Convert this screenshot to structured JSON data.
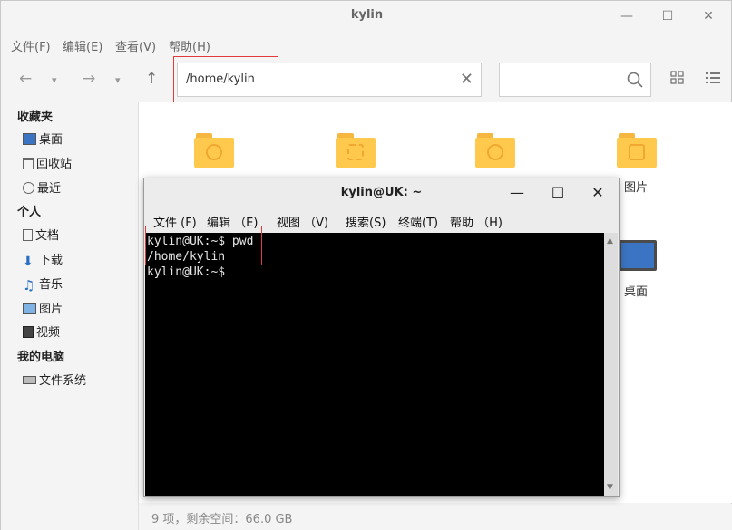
{
  "file_manager": {
    "title": "kylin",
    "menu": [
      "文件(F)",
      "编辑(E)",
      "查看(V)",
      "帮助(H)"
    ],
    "address": "/home/kylin",
    "search_placeholder": "",
    "sidebar": {
      "favorites_heading": "收藏夹",
      "favorites": [
        "桌面",
        "回收站",
        "最近"
      ],
      "personal_heading": "个人",
      "personal": [
        "文档",
        "下载",
        "音乐",
        "图片",
        "视频"
      ],
      "computer_heading": "我的电脑",
      "computer": [
        "文件系统"
      ]
    },
    "items": [
      {
        "label": "",
        "icon": "folder-people-icon"
      },
      {
        "label": "",
        "icon": "folder-template-icon"
      },
      {
        "label": "",
        "icon": "folder-video-icon"
      },
      {
        "label": "图片",
        "icon": "folder-pictures-icon"
      },
      {
        "label": "桌面",
        "icon": "desktop-monitor-icon"
      }
    ],
    "status": "9 项，剩余空间：66.0 GB"
  },
  "terminal": {
    "title": "kylin@UK: ~",
    "menu": [
      "文件 (F)",
      "编辑 （E)",
      "视图 （V)",
      "搜索(S)",
      "终端(T)",
      "帮助 （H)"
    ],
    "lines": [
      "kylin@UK:~$ pwd",
      "/home/kylin",
      "kylin@UK:~$"
    ]
  },
  "colors": {
    "highlight": "#e23a3a",
    "folder": "#ffc94d",
    "terminal_bg": "#000000"
  }
}
